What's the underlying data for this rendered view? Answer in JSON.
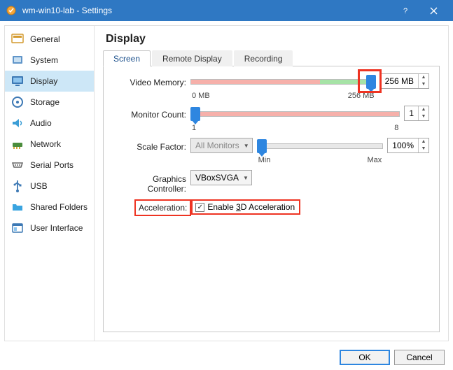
{
  "window": {
    "title": "wm-win10-lab - Settings",
    "help_icon": "help-icon",
    "close_icon": "close-icon"
  },
  "sidebar": {
    "items": [
      {
        "label": "General"
      },
      {
        "label": "System"
      },
      {
        "label": "Display"
      },
      {
        "label": "Storage"
      },
      {
        "label": "Audio"
      },
      {
        "label": "Network"
      },
      {
        "label": "Serial Ports"
      },
      {
        "label": "USB"
      },
      {
        "label": "Shared Folders"
      },
      {
        "label": "User Interface"
      }
    ],
    "selected_index": 2
  },
  "main": {
    "title": "Display",
    "tabs": [
      {
        "label": "Screen",
        "active": true
      },
      {
        "label": "Remote Display",
        "active": false
      },
      {
        "label": "Recording",
        "active": false
      }
    ],
    "video_memory": {
      "label": "Video Memory:",
      "value": "256 MB",
      "min_tick": "0 MB",
      "max_tick": "256 MB",
      "slider_percent": 100
    },
    "monitor_count": {
      "label": "Monitor Count:",
      "value": "1",
      "min_tick": "1",
      "max_tick": "8",
      "slider_percent": 0
    },
    "scale_factor": {
      "label": "Scale Factor:",
      "monitors_combo": "All Monitors",
      "value": "100%",
      "min_tick": "Min",
      "max_tick": "Max",
      "slider_percent": 0
    },
    "graphics_controller": {
      "label": "Graphics Controller:",
      "value": "VBoxSVGA"
    },
    "acceleration": {
      "label": "Acceleration:",
      "checkbox_label_pre": "Enable ",
      "checkbox_label_u": "3",
      "checkbox_label_post": "D Acceleration",
      "checked": true
    }
  },
  "buttons": {
    "ok": "OK",
    "cancel": "Cancel"
  }
}
